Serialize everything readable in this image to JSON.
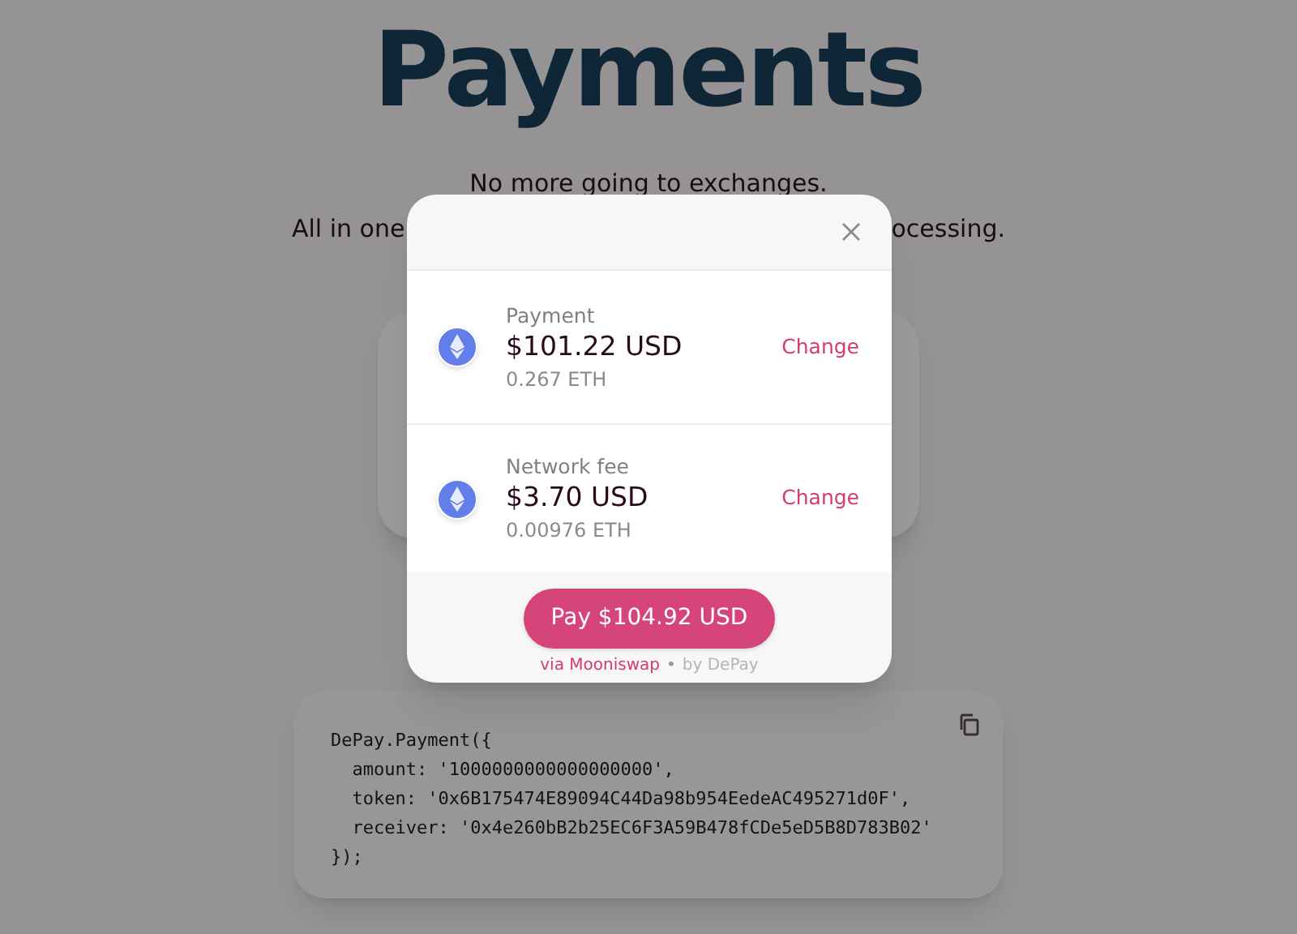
{
  "page": {
    "title": "Payments",
    "tagline": "No more going to exchanges.",
    "tagline_fragments": [
      "All in one",
      "ocessing."
    ]
  },
  "dialog": {
    "rows": [
      {
        "label": "Payment",
        "amount": "$101.22 USD",
        "crypto": "0.267 ETH",
        "action": "Change"
      },
      {
        "label": "Network fee",
        "amount": "$3.70 USD",
        "crypto": "0.00976 ETH",
        "action": "Change"
      }
    ],
    "pay_button": "Pay $104.92 USD",
    "provider_link": "via Mooniswap",
    "separator": "•",
    "credit": "by DePay"
  },
  "code": {
    "lines": [
      "DePay.Payment({",
      "  amount: '1000000000000000000',",
      "  token: '0x6B175474E89094C44Da98b954EedeAC495271d0F',",
      "  receiver: '0x4e260bB2b25EC6F3A59B478fCDe5eD5B8D783B02'",
      "});"
    ]
  }
}
